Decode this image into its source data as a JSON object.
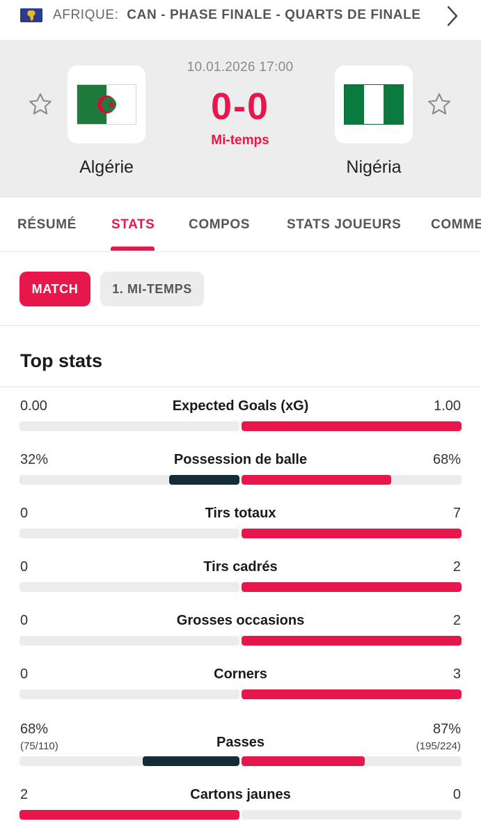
{
  "competition": {
    "region": "AFRIQUE:",
    "name": "CAN - PHASE FINALE - QUARTS DE FINALE",
    "flag_icon": "africa-map-icon",
    "nav_icon": "chevron-right-icon"
  },
  "match": {
    "date": "10.01.2026 17:00",
    "score": "0-0",
    "status": "Mi-temps",
    "home": {
      "name": "Algérie",
      "flag_icon": "algeria-flag-icon"
    },
    "away": {
      "name": "Nigéria",
      "flag_icon": "nigeria-flag-icon"
    },
    "favorite_icon": "star-outline-icon"
  },
  "tabs": [
    {
      "label": "RÉSUMÉ",
      "active": false
    },
    {
      "label": "STATS",
      "active": true
    },
    {
      "label": "COMPOS",
      "active": false
    },
    {
      "label": "STATS JOUEURS",
      "active": false
    },
    {
      "label": "COMMENTAIRES",
      "active": false
    }
  ],
  "filters": [
    {
      "label": "MATCH",
      "active": true
    },
    {
      "label": "1. MI-TEMPS",
      "active": false
    }
  ],
  "section_title": "Top stats",
  "colors": {
    "accent": "#e8174b",
    "dark_bar": "#142c38",
    "track": "#ececec",
    "header_bg": "#ededed"
  },
  "stats": [
    {
      "label": "Expected Goals (xG)",
      "home": "0.00",
      "away": "1.00",
      "home_share": 0.0,
      "away_share": 1.0,
      "leader": "away"
    },
    {
      "label": "Possession de balle",
      "home": "32%",
      "away": "68%",
      "home_share": 0.32,
      "away_share": 0.68,
      "leader": "away"
    },
    {
      "label": "Tirs totaux",
      "home": "0",
      "away": "7",
      "home_share": 0.0,
      "away_share": 1.0,
      "leader": "away"
    },
    {
      "label": "Tirs cadrés",
      "home": "0",
      "away": "2",
      "home_share": 0.0,
      "away_share": 1.0,
      "leader": "away"
    },
    {
      "label": "Grosses occasions",
      "home": "0",
      "away": "2",
      "home_share": 0.0,
      "away_share": 1.0,
      "leader": "away"
    },
    {
      "label": "Corners",
      "home": "0",
      "away": "3",
      "home_share": 0.0,
      "away_share": 1.0,
      "leader": "away"
    },
    {
      "label": "Passes",
      "home": "68%",
      "home_sub": "(75/110)",
      "away": "87%",
      "away_sub": "(195/224)",
      "home_share": 0.44,
      "away_share": 0.56,
      "leader": "away"
    },
    {
      "label": "Cartons jaunes",
      "home": "2",
      "away": "0",
      "home_share": 1.0,
      "away_share": 0.0,
      "leader": "home"
    }
  ]
}
